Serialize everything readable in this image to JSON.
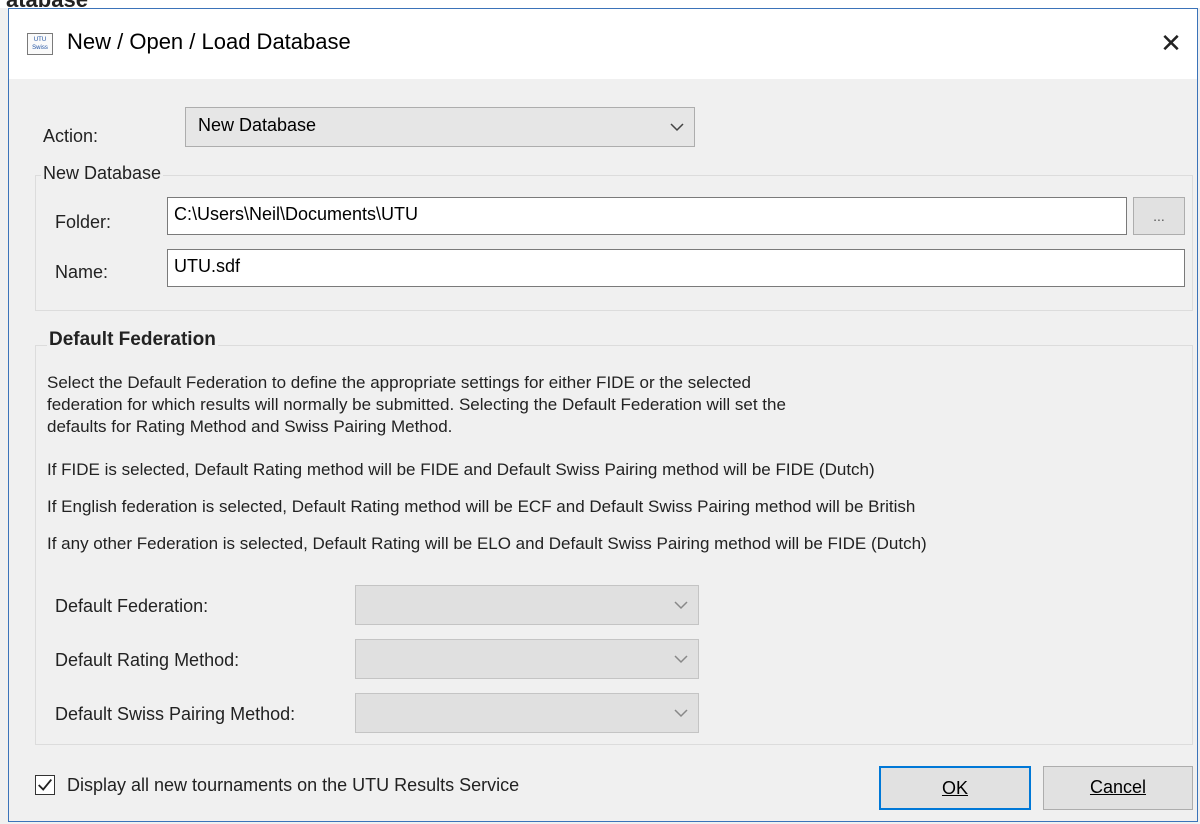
{
  "background_window": {
    "title_fragment": "atabase"
  },
  "dialog": {
    "title": "New / Open / Load Database",
    "icon_text_line1": "UTU",
    "icon_text_line2": "Swiss",
    "close_glyph": "✕"
  },
  "action": {
    "label": "Action:",
    "selected": "New Database"
  },
  "new_database": {
    "group_title": "New Database",
    "folder_label": "Folder:",
    "folder_value": "C:\\Users\\Neil\\Documents\\UTU",
    "browse_label": "...",
    "name_label": "Name:",
    "name_value": "UTU.sdf"
  },
  "federation": {
    "heading": "Default Federation",
    "description_line1": "Select the Default Federation to define the appropriate settings for either FIDE or the selected",
    "description_line2": "federation for which results will normally be submitted. Selecting the Default Federation will set the",
    "description_line3": "defaults for Rating Method and Swiss Pairing Method.",
    "rule_fide": "If FIDE is selected, Default Rating method will be FIDE and Default Swiss Pairing method will be FIDE (Dutch)",
    "rule_english": "If English federation is selected, Default Rating method will be ECF and Default Swiss Pairing method will be British",
    "rule_other": "If any other Federation is selected, Default Rating will be ELO and Default Swiss Pairing method will be FIDE (Dutch)",
    "default_federation_label": "Default Federation:",
    "default_federation_value": "",
    "default_rating_label": "Default Rating Method:",
    "default_rating_value": "",
    "default_pairing_label": "Default Swiss Pairing Method:",
    "default_pairing_value": ""
  },
  "footer": {
    "display_checkbox_checked": true,
    "display_checkbox_label": "Display all new tournaments on the UTU Results Service",
    "ok_label": "OK",
    "cancel_label": "Cancel"
  },
  "colors": {
    "window_border": "#3b73b9",
    "default_button_border": "#0078d7",
    "dialog_background": "#f0f0f0"
  }
}
